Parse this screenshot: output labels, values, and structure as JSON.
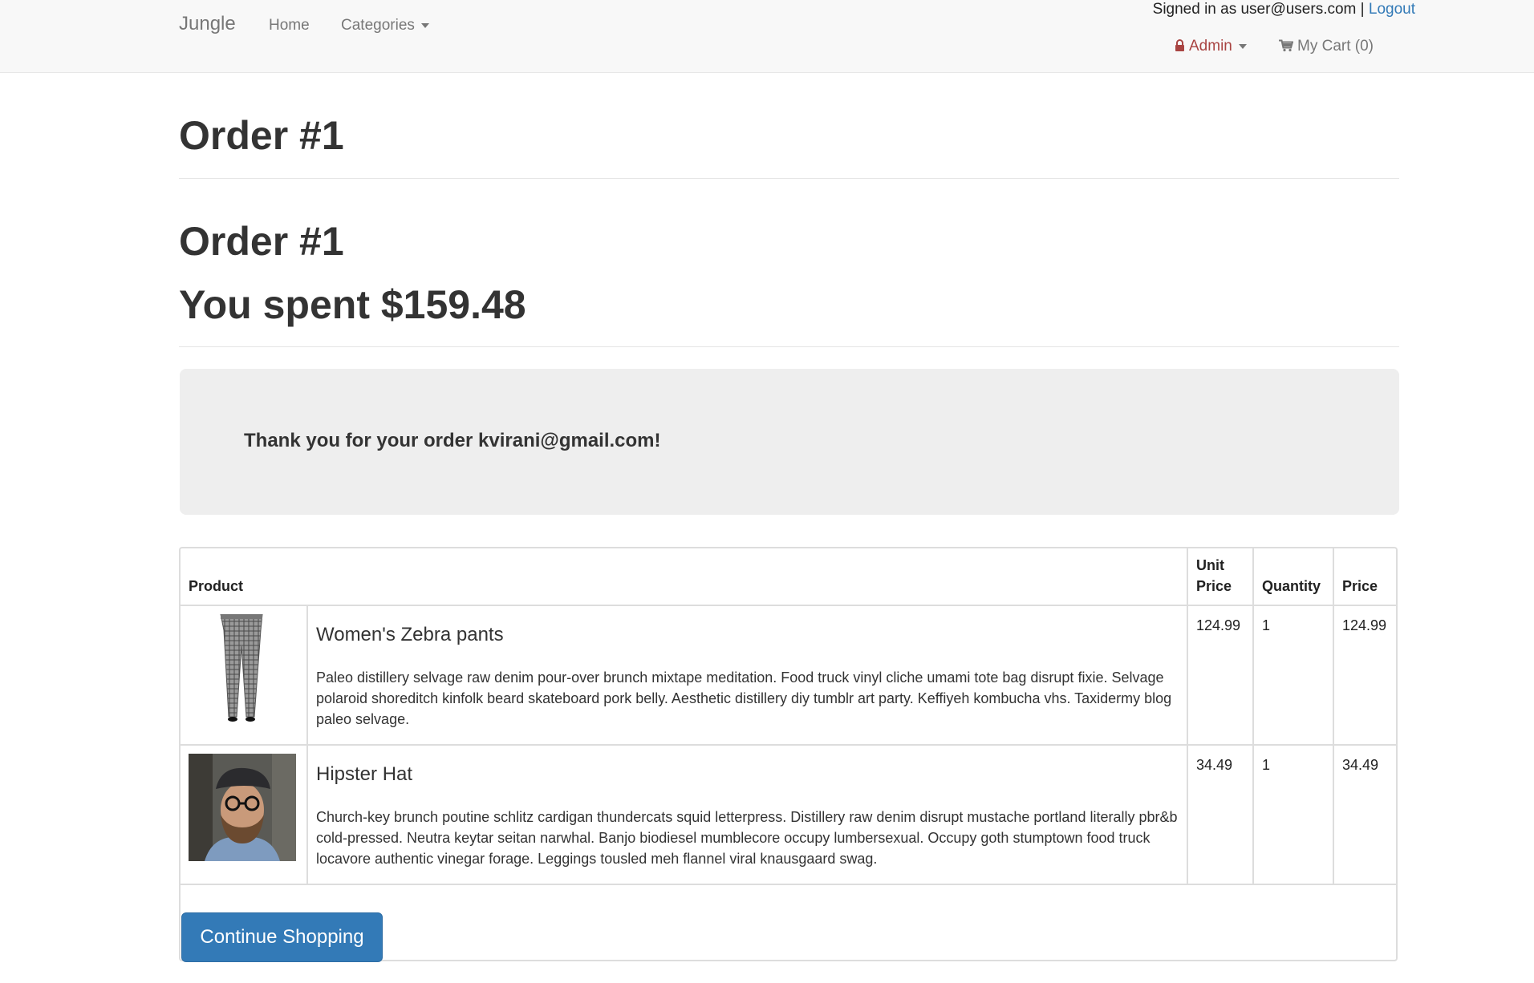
{
  "navbar": {
    "brand": "Jungle",
    "home": "Home",
    "categories": "Categories",
    "signed_in_text": "Signed in as user@users.com |",
    "logout": "Logout",
    "admin": "Admin",
    "cart": "My Cart (0)"
  },
  "page": {
    "title": "Order #1",
    "order_heading": "Order #1",
    "spent": "You spent $159.48",
    "thank_you": "Thank you for your order kvirani@gmail.com!"
  },
  "table": {
    "headers": {
      "product": "Product",
      "unit_price": "Unit Price",
      "quantity": "Quantity",
      "price": "Price"
    },
    "rows": [
      {
        "name": "Women's Zebra pants",
        "description": "Paleo distillery selvage raw denim pour-over brunch mixtape meditation. Food truck vinyl cliche umami tote bag disrupt fixie. Selvage polaroid shoreditch kinfolk beard skateboard pork belly. Aesthetic distillery diy tumblr art party. Keffiyeh kombucha vhs. Taxidermy blog paleo selvage.",
        "unit_price": "124.99",
        "quantity": "1",
        "price": "124.99"
      },
      {
        "name": "Hipster Hat",
        "description": "Church-key brunch poutine schlitz cardigan thundercats squid letterpress. Distillery raw denim disrupt mustache portland literally pbr&b cold-pressed. Neutra keytar seitan narwhal. Banjo biodiesel mumblecore occupy lumbersexual. Occupy goth stumptown food truck locavore authentic vinegar forage. Leggings tousled meh flannel viral knausgaard swag.",
        "unit_price": "34.49",
        "quantity": "1",
        "price": "34.49"
      }
    ]
  },
  "actions": {
    "continue_shopping": "Continue Shopping"
  },
  "colors": {
    "primary": "#337ab7",
    "admin": "#a94442",
    "navbar_bg": "#f8f8f8",
    "jumbotron_bg": "#eeeeee"
  }
}
